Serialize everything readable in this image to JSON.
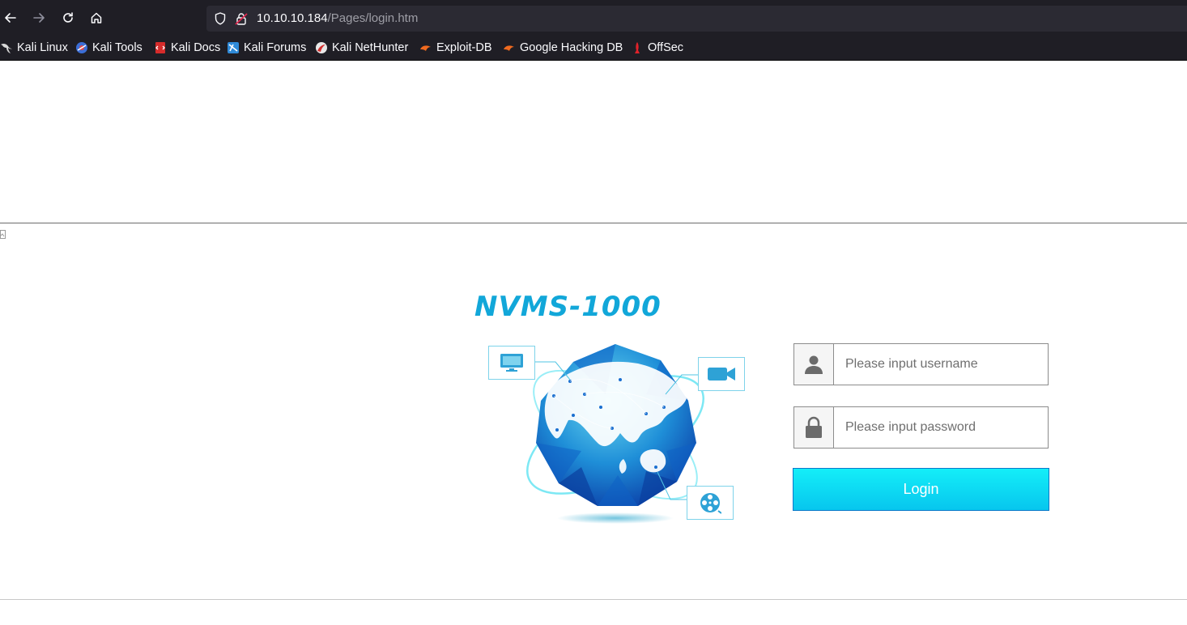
{
  "browser": {
    "url_host": "10.10.10.184",
    "url_path": "/Pages/login.htm",
    "nav": {
      "back_icon": "back-arrow-icon",
      "forward_icon": "forward-arrow-icon",
      "reload_icon": "reload-icon",
      "home_icon": "home-icon"
    },
    "bookmarks": [
      {
        "label": "Kali Linux",
        "icon": "kali-dragon-icon"
      },
      {
        "label": "Kali Tools",
        "icon": "kali-tools-icon"
      },
      {
        "label": "Kali Docs",
        "icon": "kali-docs-icon"
      },
      {
        "label": "Kali Forums",
        "icon": "kali-forums-icon"
      },
      {
        "label": "Kali NetHunter",
        "icon": "kali-nethunter-icon"
      },
      {
        "label": "Exploit-DB",
        "icon": "exploit-db-icon"
      },
      {
        "label": "Google Hacking DB",
        "icon": "ghdb-icon"
      },
      {
        "label": "OffSec",
        "icon": "offsec-icon"
      }
    ]
  },
  "login": {
    "logo": "NVMS-1000",
    "username_placeholder": "Please input username",
    "password_placeholder": "Please input password",
    "login_label": "Login"
  },
  "colors": {
    "brand": "#12a7d9",
    "button_top": "#14eef8",
    "button_bottom": "#07c6ee",
    "globe_dark": "#0b4fb8",
    "globe_light": "#37c7e6"
  }
}
